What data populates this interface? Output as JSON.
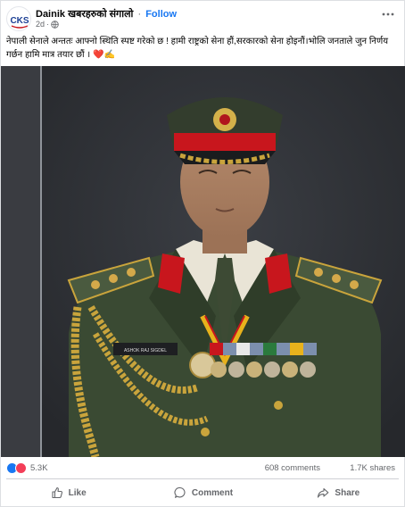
{
  "post": {
    "page_name": "Dainik खबरहरुको संगालो",
    "separator": "·",
    "follow_label": "Follow",
    "time": "2d",
    "time_dot": "·",
    "text": "नेपाली सेनाले अन्ततः आफ्नो स्थिति स्पष्ट गरेको छ ! हामी राष्ट्रको सेना हौं,सरकारको सेना होइनौं।भोलि जनताले जुन निर्णय गर्छन हामि मात्र तयार छौं । ❤️✍️",
    "avatar_text": "CKS"
  },
  "photo": {
    "name_tag": "ASHOK RAJ SIGDEL"
  },
  "stats": {
    "reaction_count": "5.3K",
    "comments": "608 comments",
    "shares": "1.7K shares"
  },
  "actions": {
    "like": "Like",
    "comment": "Comment",
    "share": "Share"
  },
  "colors": {
    "link": "#1877f2",
    "love": "#f33e58",
    "muted": "#65676b",
    "uniform": "#3a4a33",
    "cap_band": "#c8161d"
  }
}
